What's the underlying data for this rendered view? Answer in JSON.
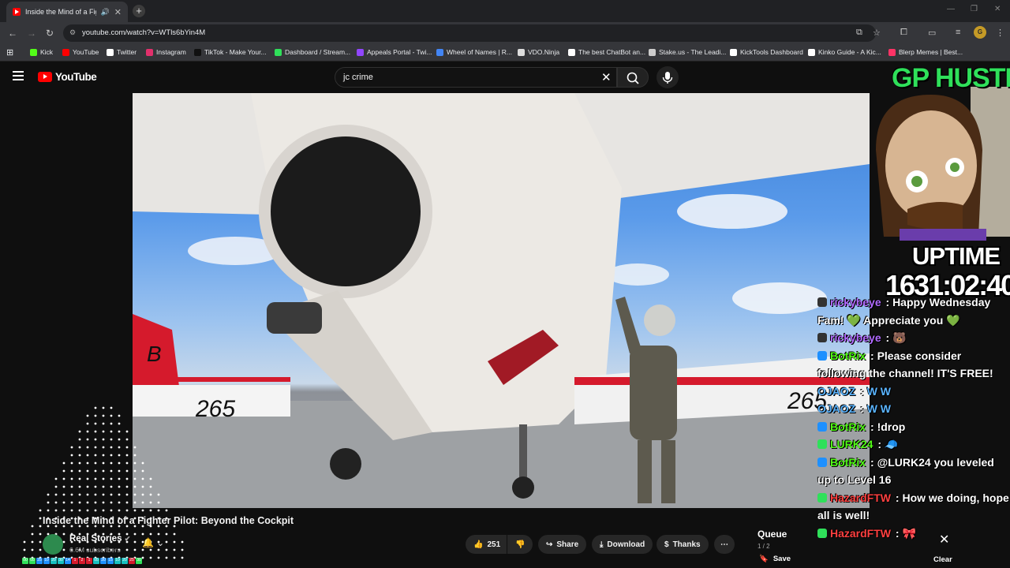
{
  "browser": {
    "tab_title": "Inside the Mind of a Fighter",
    "url": "youtube.com/watch?v=WTls6bYin4M",
    "bookmarks": [
      {
        "label": "Kick",
        "color": "#53fc18"
      },
      {
        "label": "YouTube",
        "color": "#ff0000"
      },
      {
        "label": "Twitter",
        "color": "#ffffff"
      },
      {
        "label": "Instagram",
        "color": "#e1306c"
      },
      {
        "label": "TikTok - Make Your...",
        "color": "#111111"
      },
      {
        "label": "Dashboard / Stream...",
        "color": "#2fe05a"
      },
      {
        "label": "Appeals Portal - Twi...",
        "color": "#9146ff"
      },
      {
        "label": "Wheel of Names | R...",
        "color": "#4285f4"
      },
      {
        "label": "VDO.Ninja",
        "color": "#dddddd"
      },
      {
        "label": "The best ChatBot an...",
        "color": "#ffffff"
      },
      {
        "label": "Stake.us - The Leadi...",
        "color": "#cccccc"
      },
      {
        "label": "KickTools Dashboard",
        "color": "#ffffff"
      },
      {
        "label": "Kinko Guide - A Kic...",
        "color": "#ffffff"
      },
      {
        "label": "Blerp Memes | Best...",
        "color": "#ff3366"
      }
    ]
  },
  "youtube": {
    "logo_text": "YouTube",
    "search_query": "jc crime",
    "video_title": "Inside the Mind of a Fighter Pilot: Beyond the Cockpit",
    "channel_name": "Real Stories",
    "subscribers": "6.6M subscribers",
    "likes": "251",
    "actions": {
      "share": "Share",
      "download": "Download",
      "thanks": "Thanks"
    },
    "queue": {
      "title": "Queue",
      "count": "1 / 2",
      "save": "Save",
      "clear": "Clear"
    },
    "video_scene": {
      "plane_number_left": "265",
      "plane_number_right": "265",
      "tail_letter": "B"
    }
  },
  "overlay": {
    "brand": "GP HUSTLA",
    "uptime_label": "UPTIME",
    "uptime_value": "1631:02:40",
    "chat": [
      {
        "user": "rickybeye",
        "color": "#b26bff",
        "text": "Happy Wednesday Fam! 💚 Appreciate you 💚",
        "badge": "#333333"
      },
      {
        "user": "rickybeye",
        "color": "#b26bff",
        "text": "🐻",
        "badge": "#333333"
      },
      {
        "user": "BotRix",
        "color": "#53fc18",
        "text": "Please consider following the channel! IT'S FREE!",
        "badge": "#1e90ff"
      },
      {
        "user": "OJAOZ",
        "color": "#5ab4ff",
        "text": "W  W",
        "badge": ""
      },
      {
        "user": "OJAOZ",
        "color": "#5ab4ff",
        "text": "W  W",
        "badge": ""
      },
      {
        "user": "BotRix",
        "color": "#53fc18",
        "text": "!drop",
        "badge": "#1e90ff"
      },
      {
        "user": "LURK24",
        "color": "#53fc18",
        "text": "🧢",
        "badge": "#2fe05a"
      },
      {
        "user": "BotRix",
        "color": "#53fc18",
        "text": "@LURK24 you leveled up to Level 16",
        "badge": "#1e90ff"
      },
      {
        "user": "HazardFTW",
        "color": "#ff4040",
        "text": "How we doing, hope all is well!",
        "badge": "#2fe05a"
      },
      {
        "user": "HazardFTW",
        "color": "#ff4040",
        "text": "🎀",
        "badge": "#2fe05a"
      }
    ]
  },
  "stream_bar": [
    "00",
    "05",
    "25",
    "10",
    "20",
    "30",
    "14",
    "1",
    "2",
    "1",
    "05",
    "20",
    "15",
    "10",
    "20",
    "25",
    "30"
  ]
}
